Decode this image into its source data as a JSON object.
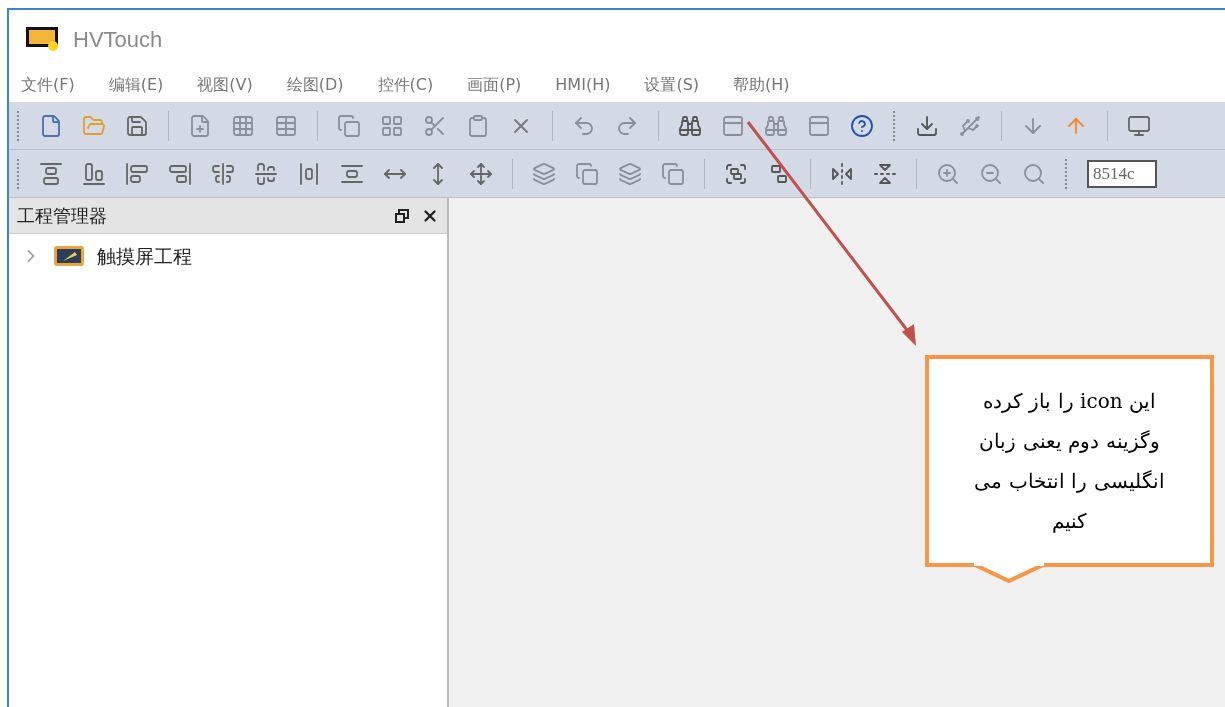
{
  "window": {
    "title": "HVTouch"
  },
  "menu": [
    "文件(F)",
    "编辑(E)",
    "视图(V)",
    "绘图(D)",
    "控件(C)",
    "画面(P)",
    "HMI(H)",
    "设置(S)",
    "帮助(H)"
  ],
  "toolbar_field": {
    "value": "8514c"
  },
  "project_panel": {
    "title": "工程管理器",
    "tree": [
      {
        "label": "触摸屏工程",
        "expanded": false
      }
    ]
  },
  "callout": {
    "lines": [
      "این  icon را باز کرده",
      "وگزینه دوم یعنی زبان",
      "انگلیسی را انتخاب می",
      "کنیم"
    ]
  }
}
